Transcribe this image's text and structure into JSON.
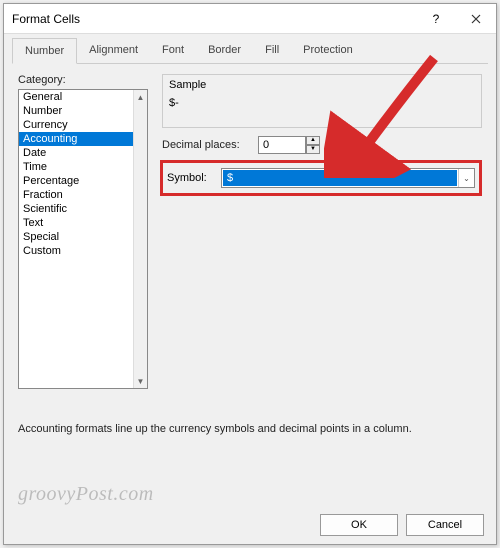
{
  "title": "Format Cells",
  "tabs": [
    "Number",
    "Alignment",
    "Font",
    "Border",
    "Fill",
    "Protection"
  ],
  "active_tab_index": 0,
  "category_label": "Category:",
  "categories": [
    "General",
    "Number",
    "Currency",
    "Accounting",
    "Date",
    "Time",
    "Percentage",
    "Fraction",
    "Scientific",
    "Text",
    "Special",
    "Custom"
  ],
  "selected_category_index": 3,
  "sample": {
    "label": "Sample",
    "value": "$-"
  },
  "decimal_places": {
    "label": "Decimal places:",
    "value": "0"
  },
  "symbol": {
    "label": "Symbol:",
    "value": "$"
  },
  "description": "Accounting formats line up the currency symbols and decimal points in a column.",
  "buttons": {
    "ok": "OK",
    "cancel": "Cancel"
  },
  "watermark": "groovyPost.com"
}
